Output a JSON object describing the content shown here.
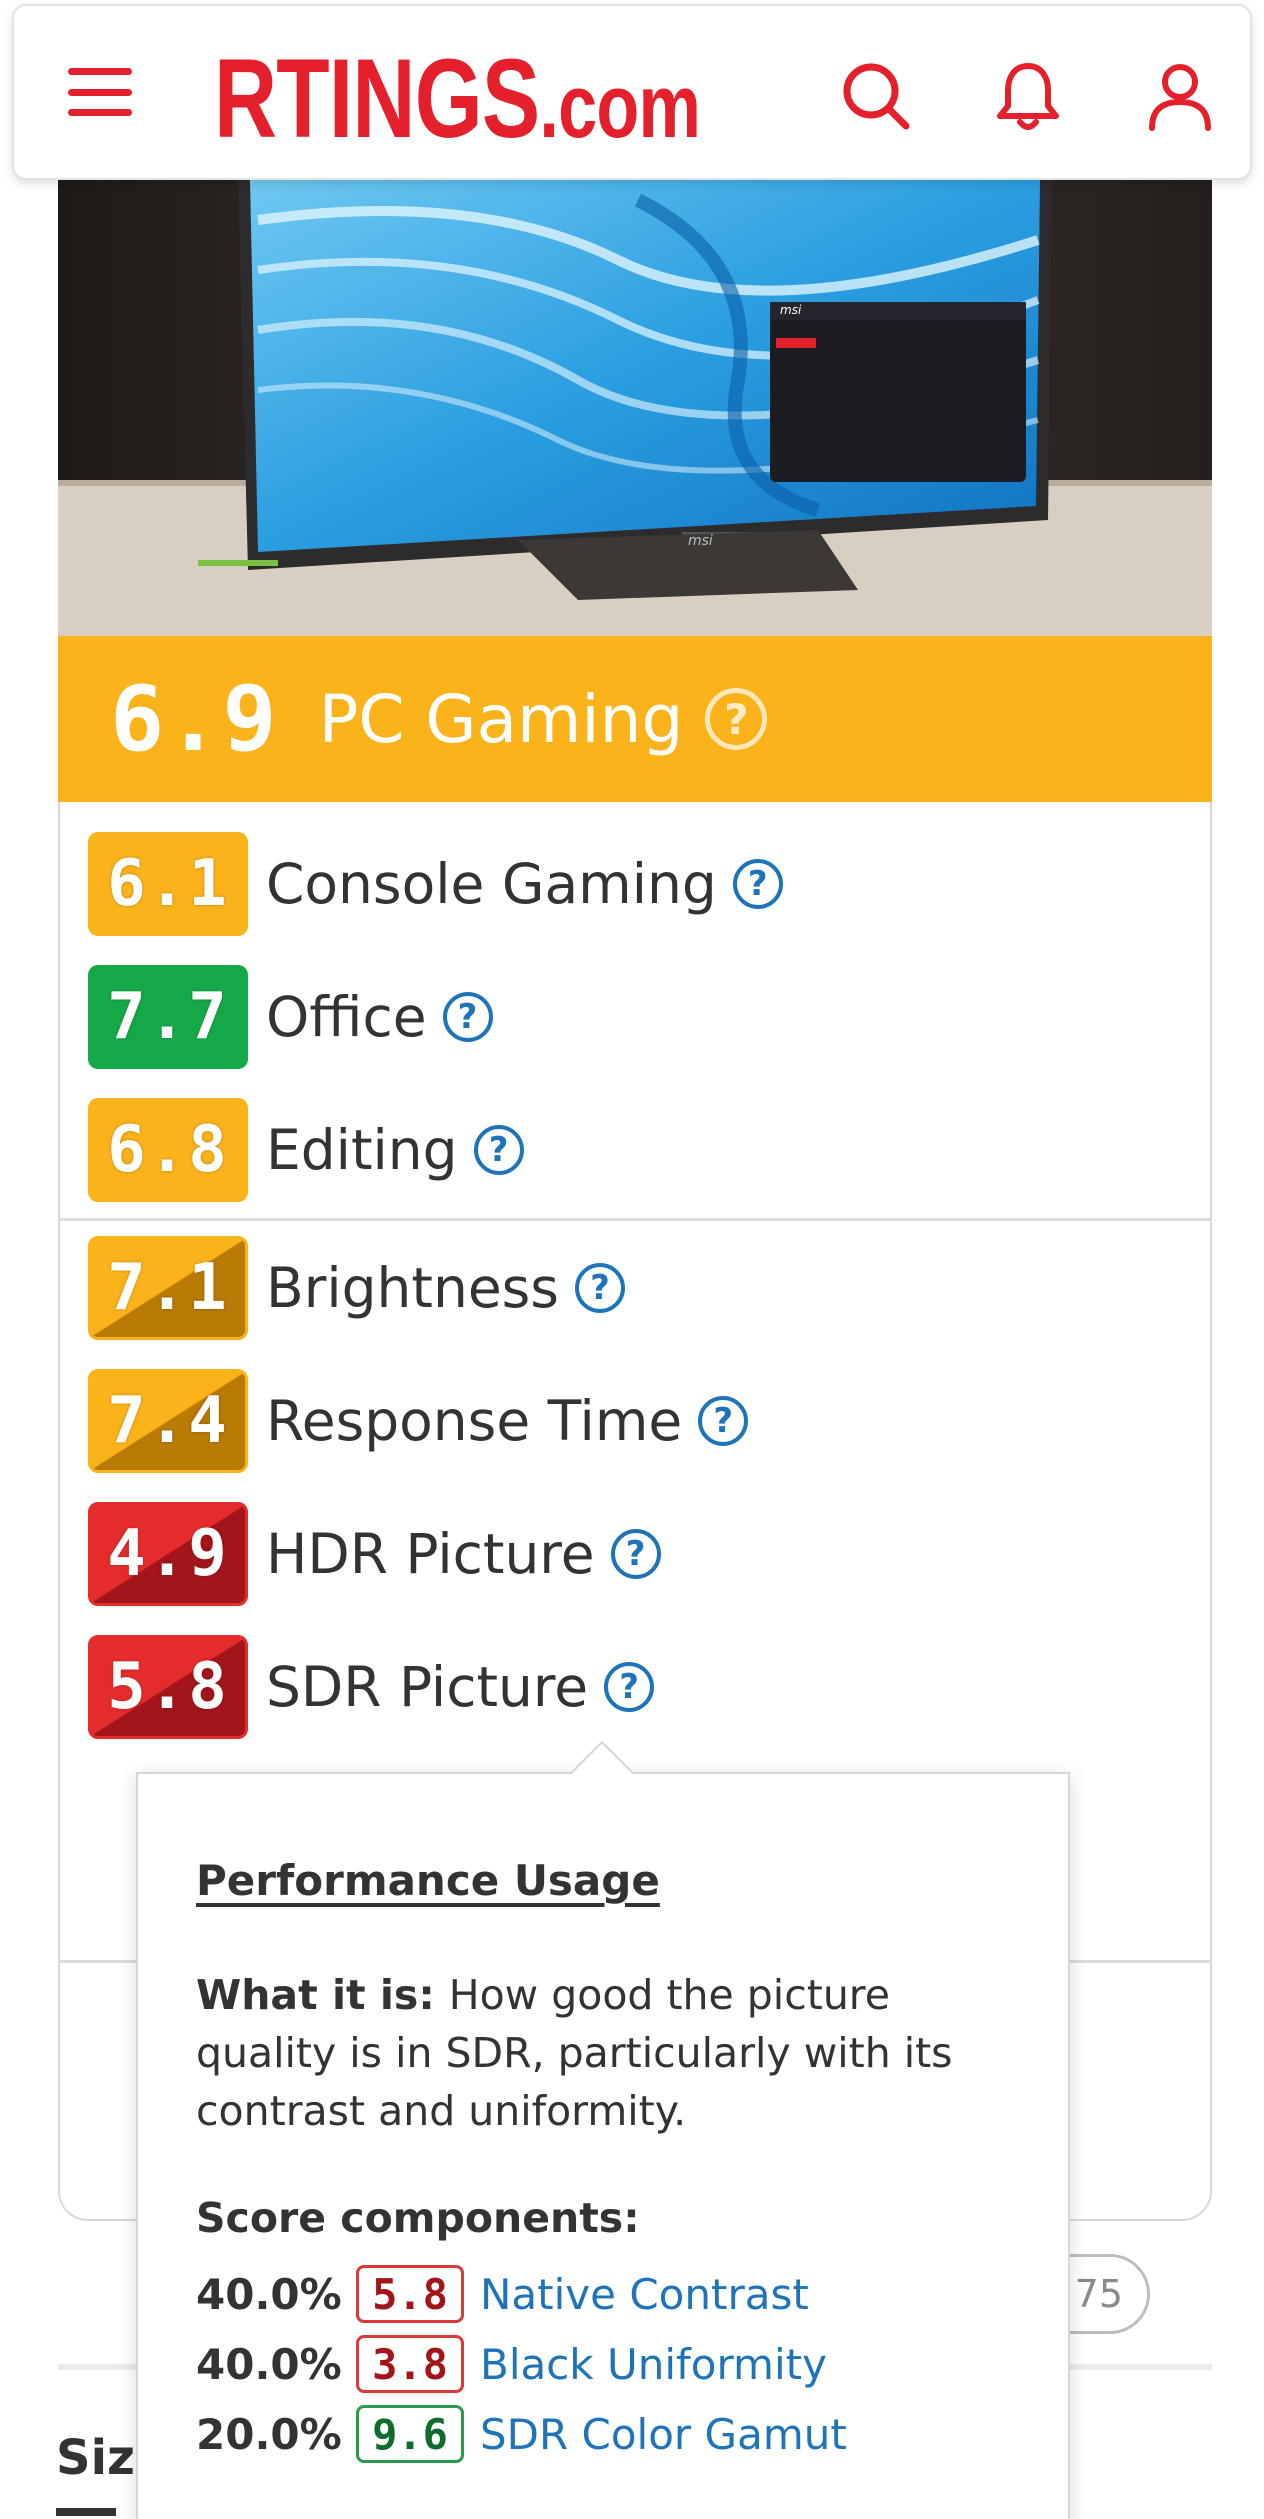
{
  "header": {
    "logo_main": "RTINGS",
    "logo_suffix": ".com",
    "icons": [
      "hamburger-menu-icon",
      "search-icon",
      "bell-icon",
      "user-icon"
    ]
  },
  "product_image": {
    "screen_brand": "msi",
    "stand_brand": "msi"
  },
  "primary_score": {
    "score": "6.9",
    "label": "PC Gaming",
    "help": "?",
    "color": "#fbb31c"
  },
  "usage_scores": [
    {
      "score": "6.1",
      "label": "Console Gaming",
      "help": "?",
      "color": "#fbb31c"
    },
    {
      "score": "7.7",
      "label": "Office",
      "help": "?",
      "color": "#15a849"
    },
    {
      "score": "6.8",
      "label": "Editing",
      "help": "?",
      "color": "#fbb31c"
    }
  ],
  "performance_scores": [
    {
      "score": "7.1",
      "label": "Brightness",
      "help": "?",
      "color": "#fbb31c"
    },
    {
      "score": "7.4",
      "label": "Response Time",
      "help": "?",
      "color": "#fbb31c"
    },
    {
      "score": "4.9",
      "label": "HDR Picture",
      "help": "?",
      "color": "#e52c2c"
    },
    {
      "score": "5.8",
      "label": "SDR Picture",
      "help": "?",
      "color": "#e52c2c"
    }
  ],
  "tooltip": {
    "title": "Performance Usage",
    "what_it_is_label": "What it is:",
    "what_it_is_text": "How good the picture quality is in SDR, particularly with its contrast and uniformity.",
    "components_title": "Score components:",
    "components": [
      {
        "weight": "40.0%",
        "score": "5.8",
        "name": "Native Contrast",
        "color": "#d83a3a"
      },
      {
        "weight": "40.0%",
        "score": "3.8",
        "name": "Black Uniformity",
        "color": "#d83a3a"
      },
      {
        "weight": "20.0%",
        "score": "9.6",
        "name": "SDR Color Gamut",
        "color": "#2a9a4b"
      }
    ]
  },
  "background": {
    "pill_text": "75",
    "size_label": "Size"
  }
}
